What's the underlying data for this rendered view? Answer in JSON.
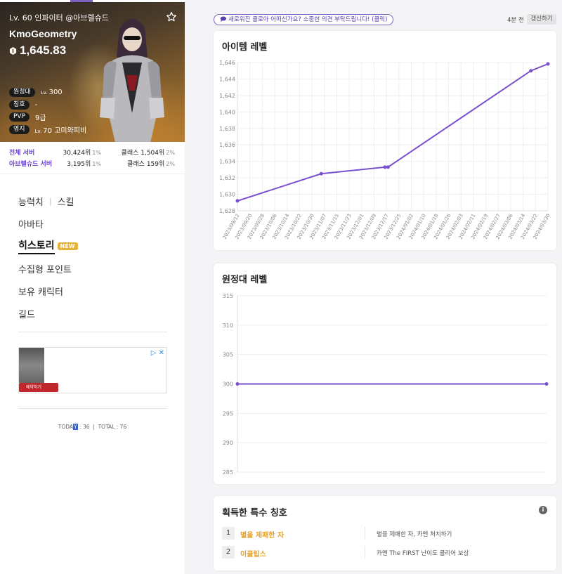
{
  "profile": {
    "level_line": "Lv. 60 인파이터 @아브렐슈드",
    "name": "KmoGeometry",
    "item_level": "1,645.83",
    "stats": [
      {
        "label": "원정대",
        "prefix": "Lv.",
        "value": "300"
      },
      {
        "label": "칭호",
        "prefix": "",
        "value": "-"
      },
      {
        "label": "PVP",
        "prefix": "",
        "value": "9급"
      },
      {
        "label": "영지",
        "prefix": "Lv.",
        "value": "70 고미와피비"
      }
    ]
  },
  "ranks": [
    {
      "label": "전체 서버",
      "rank": "30,424위",
      "pct": "1%",
      "class_rank": "클래스 1,504위",
      "class_pct": "2%"
    },
    {
      "label": "아브렐슈드 서버",
      "rank": "3,195위",
      "pct": "1%",
      "class_rank": "클래스 159위",
      "class_pct": "2%"
    }
  ],
  "nav": {
    "stats": "능력치",
    "skills": "스킬",
    "avatar": "아바타",
    "history": "히스토리",
    "history_badge": "NEW",
    "collectibles": "수집형 포인트",
    "characters": "보유 캐릭터",
    "guild": "길드"
  },
  "ad": {
    "button": "예약하기"
  },
  "counter": {
    "today_label": "TODA",
    "today_cursor": "Y",
    "today_value": ": 36",
    "total": "TOTAL : 76"
  },
  "header": {
    "banner": "새로워진 클로아 어떠신가요? 소중한 의견 부탁드립니다! (클릭)",
    "updated": "4분 전",
    "refresh": "갱신하기"
  },
  "colors": {
    "accent": "#7a4fd0",
    "title_gold": "#e6a12a",
    "rank_purple": "#6a43d6"
  },
  "chart_data": [
    {
      "type": "line",
      "title": "아이템 레벨",
      "x": [
        "2023/09/12",
        "2023/09/20",
        "2023/09/28",
        "2023/10/06",
        "2023/10/14",
        "2023/10/22",
        "2023/10/30",
        "2023/11/07",
        "2023/11/15",
        "2023/11/23",
        "2023/12/01",
        "2023/12/09",
        "2023/12/17",
        "2023/12/25",
        "2024/01/02",
        "2024/01/10",
        "2024/01/18",
        "2024/01/26",
        "2024/02/03",
        "2024/02/11",
        "2024/02/19",
        "2024/02/27",
        "2024/03/06",
        "2024/03/14",
        "2024/03/22",
        "2024/03/30"
      ],
      "yticks": [
        "1,646",
        "1,644",
        "1,642",
        "1,640",
        "1,638",
        "1,636",
        "1,634",
        "1,632",
        "1,630",
        "1,628"
      ],
      "ylim": [
        1628,
        1646
      ],
      "points": [
        {
          "x": "2023/09/12",
          "y": 1629.2
        },
        {
          "x": "2023/11/05",
          "y": 1632.5
        },
        {
          "x": "2023/12/16",
          "y": 1633.3
        },
        {
          "x": "2023/12/18",
          "y": 1633.3
        },
        {
          "x": "2024/03/19",
          "y": 1645.0
        },
        {
          "x": "2024/03/30",
          "y": 1645.83
        }
      ],
      "grid": true,
      "color": "#7a4fd0"
    },
    {
      "type": "line",
      "title": "원정대 레벨",
      "yticks": [
        "315",
        "310",
        "305",
        "300",
        "295",
        "290",
        "285"
      ],
      "ylim": [
        285,
        315
      ],
      "points": [
        {
          "x": "start",
          "y": 300
        },
        {
          "x": "end",
          "y": 300
        }
      ],
      "grid": true,
      "color": "#7a4fd0"
    }
  ],
  "special_titles": {
    "heading": "획득한 특수 칭호",
    "items": [
      {
        "num": "1",
        "name": "별을 제패한 자",
        "desc": "별을 제패한 자, 카멘 처치하기"
      },
      {
        "num": "2",
        "name": "이클립스",
        "desc": "카멘 The FIRST 난이도 클리어 보상"
      }
    ]
  }
}
